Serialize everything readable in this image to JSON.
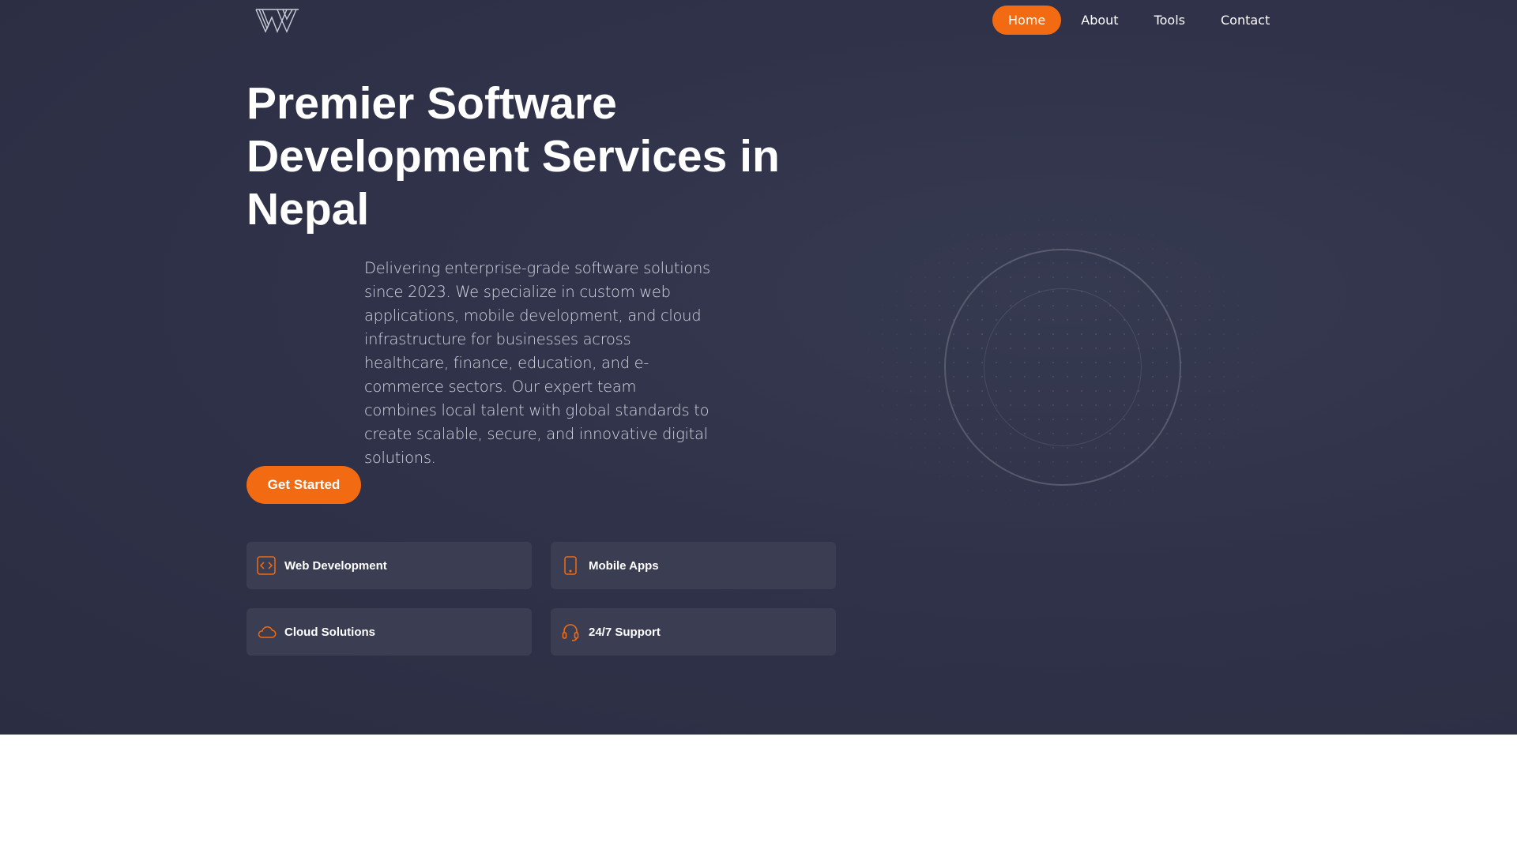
{
  "nav": {
    "items": [
      {
        "label": "Home",
        "active": true
      },
      {
        "label": "About",
        "active": false
      },
      {
        "label": "Tools",
        "active": false
      },
      {
        "label": "Contact",
        "active": false
      }
    ]
  },
  "hero": {
    "title": "Premier Software Development Services in Nepal",
    "description": "Delivering enterprise-grade software solutions since 2023. We specialize in custom web applications, mobile development, and cloud infrastructure for businesses across healthcare, finance, education, and e-commerce sectors. Our expert team combines local talent with global standards to create scalable, secure, and innovative digital solutions.",
    "cta_label": "Get Started"
  },
  "features": [
    {
      "label": "Web Development",
      "icon": "code-icon"
    },
    {
      "label": "Mobile Apps",
      "icon": "mobile-phone-icon"
    },
    {
      "label": "Cloud Solutions",
      "icon": "cloud-icon"
    },
    {
      "label": "24/7 Support",
      "icon": "headset-icon"
    }
  ],
  "colors": {
    "accent": "#f26b12",
    "hero_background": "#30324a",
    "card_background": "#3b3d52",
    "text": "#ffffff"
  }
}
